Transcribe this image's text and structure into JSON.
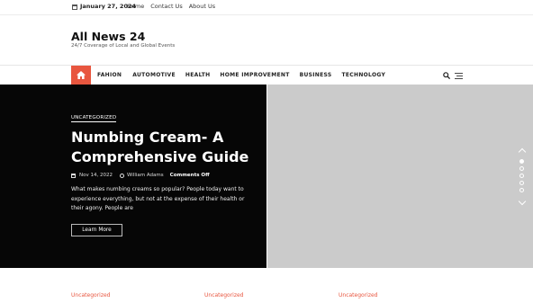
{
  "topbar": {
    "date": "January 27, 2024",
    "links": [
      "Home",
      "Contact Us",
      "About Us"
    ]
  },
  "site": {
    "title": "All News 24",
    "tagline": "24/7 Coverage of Local and Global Events"
  },
  "nav": {
    "items": [
      "FAHION",
      "AUTOMOTIVE",
      "HEALTH",
      "HOME IMPROVEMENT",
      "BUSINESS",
      "TECHNOLOGY"
    ],
    "accent": "#e8563f"
  },
  "hero": {
    "category": "UNCATEGORIZED",
    "title": "Numbing Cream- A Comprehensive Guide",
    "date": "Nov 14, 2022",
    "author": "William Adams",
    "comments": "Comments Off",
    "excerpt": "What makes numbing creams so popular? People today want to experience everything, but not at the expense of their health or their agony. People are",
    "read_more": "Learn More"
  },
  "slider": {
    "dots": 5,
    "active_dot": 1
  },
  "bottom": {
    "categories": [
      "Uncategorized",
      "Uncategorized",
      "Uncategorized"
    ]
  }
}
